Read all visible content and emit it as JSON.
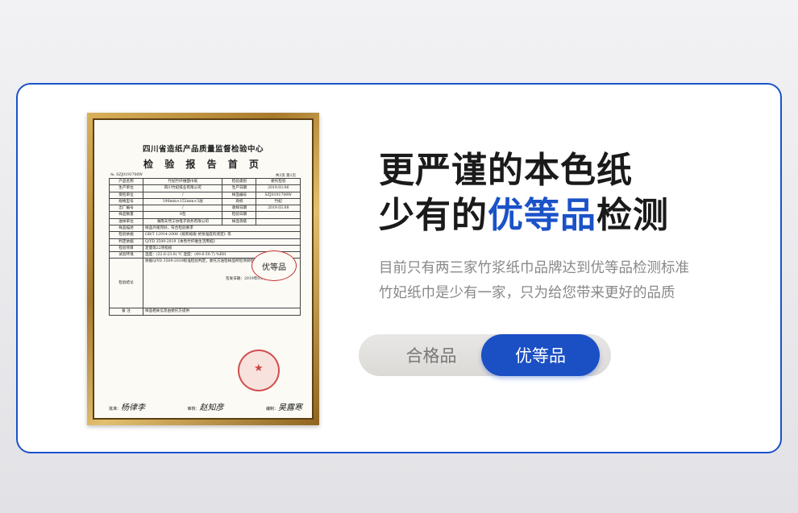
{
  "certificate": {
    "title": "四川省造纸产品质量监督检验中心",
    "subtitle": "检 验 报 告 首 页",
    "report_no": "№: SZJ0191708W",
    "page": "共3页 第1页",
    "rows": [
      {
        "l1": "产品名称",
        "v1": "竹妃竹纤维面巾纸",
        "l2": "检验类别",
        "v2": "委托检验"
      },
      {
        "l1": "生产单位",
        "v1": "四川竹妃纸业有限公司",
        "l2": "生产日期",
        "v2": "2019.03.06"
      },
      {
        "l1": "受检单位",
        "v1": "/",
        "l2": "样品编号",
        "v2": "SZJ0191708W"
      },
      {
        "l1": "规格型号",
        "v1": "190mm×152mm×3层",
        "l2": "商标",
        "v2": "竹妃"
      },
      {
        "l1": "出厂编号",
        "v1": "/",
        "l2": "收样日期",
        "v2": "2019.03.08"
      },
      {
        "l1": "样品数量",
        "v1": "8包",
        "l2": "检验日期",
        "v2": ""
      },
      {
        "l1": "送样单位",
        "v1": "湖南天然工坊电子商务有限公司",
        "l2": "样品等级",
        "v2": ""
      }
    ],
    "desc_label": "样品描述",
    "desc_value": "样品外观完好，符合检验要求",
    "basis_label": "检验依据",
    "basis_value": "GB/T 12914-2008《纸和纸板 抗张强度的测定》等",
    "judge_label": "判定依据",
    "judge_value": "Q/YD 3509-2019《本色竹纤维生活用纸》",
    "items_label": "检验项目",
    "items_value": "定量等22项指标",
    "env_label": "试验环境",
    "env_value": "温度：(22.6-23.0) ℃  湿度：(49.6-50.7) %RH",
    "conclusion_label": "检验结论",
    "conclusion_value": "依据Q/YD 3509-2019标准检验判定，委托方送检样品所检项目检验合格。",
    "seal_text": "签发日期：2019年03月22日",
    "remark_label": "备 注",
    "remark_value": "样品相关信息由委托方提供",
    "approve_label": "批准：",
    "review_label": "审核：",
    "edit_label": "编制：",
    "sig1": "杨律李",
    "sig2": "赵知彦",
    "sig3": "吴露寒",
    "grade_stamp": "优等品"
  },
  "headline": {
    "line1": "更严谨的本色纸",
    "line2_prefix": "少有的",
    "line2_highlight": "优等品",
    "line2_suffix": "检测"
  },
  "description": {
    "line1": "目前只有两三家竹浆纸巾品牌达到优等品检测标准",
    "line2": "竹妃纸巾是少有一家，只为给您带来更好的品质"
  },
  "toggle": {
    "basic_label": "合格品",
    "premium_label": "优等品",
    "selected": "优等品"
  },
  "colors": {
    "accent": "#1b52c8",
    "frame_gold": "#c89a45",
    "stamp_red": "#c53030"
  }
}
